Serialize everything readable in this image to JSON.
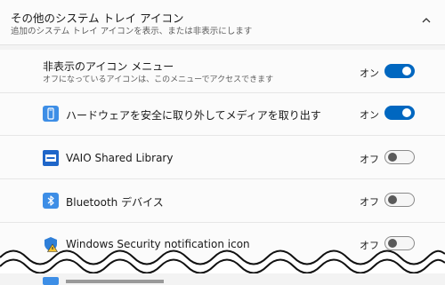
{
  "header": {
    "title": "その他のシステム トレイ アイコン",
    "subtitle": "追加のシステム トレイ アイコンを表示、または非表示にします"
  },
  "items": [
    {
      "title": "非表示のアイコン メニュー",
      "subtitle": "オフになっているアイコンは、このメニューでアクセスできます",
      "state": "オン",
      "on": true
    },
    {
      "title": "ハードウェアを安全に取り外してメディアを取り出す",
      "icon": "usb-drive-icon",
      "state": "オン",
      "on": true
    },
    {
      "title": "VAIO Shared Library",
      "icon": "vaio-library-icon",
      "state": "オフ",
      "on": false
    },
    {
      "title": "Bluetooth デバイス",
      "icon": "bluetooth-icon",
      "state": "オフ",
      "on": false
    },
    {
      "title": "Windows Security notification icon",
      "icon": "windows-security-warning-icon",
      "state": "オフ",
      "on": false
    }
  ],
  "colors": {
    "accent": "#0067c0",
    "icon_blue": "#3d8ee6"
  }
}
